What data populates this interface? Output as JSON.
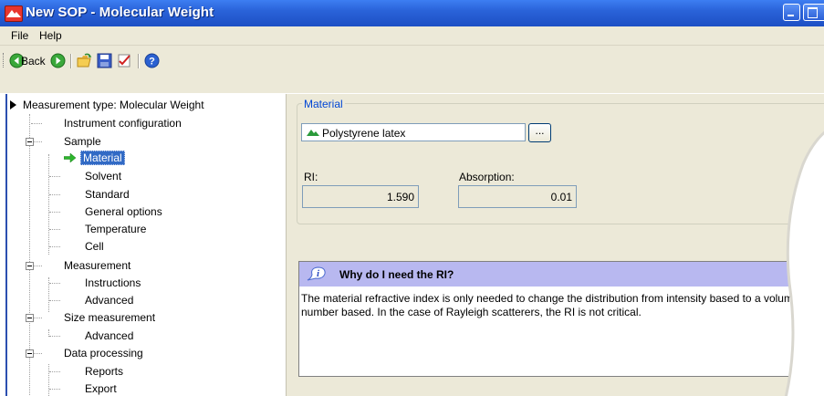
{
  "window": {
    "title": "New SOP - Molecular Weight"
  },
  "menu": {
    "items": [
      "File",
      "Help"
    ]
  },
  "toolbar": {
    "back_label": "Back",
    "icons": [
      "back-icon",
      "forward-icon",
      "open-folder-icon",
      "save-icon",
      "edit-check-icon",
      "help-icon"
    ]
  },
  "tree": {
    "root": "Measurement type: Molecular Weight",
    "items": [
      {
        "label": "Instrument configuration",
        "level": 1,
        "expandable": false
      },
      {
        "label": "Sample",
        "level": 1,
        "expandable": true
      },
      {
        "label": "Material",
        "level": 2,
        "selected": true
      },
      {
        "label": "Solvent",
        "level": 2
      },
      {
        "label": "Standard",
        "level": 2
      },
      {
        "label": "General options",
        "level": 2
      },
      {
        "label": "Temperature",
        "level": 2
      },
      {
        "label": "Cell",
        "level": 2
      },
      {
        "label": "Measurement",
        "level": 1,
        "expandable": true
      },
      {
        "label": "Instructions",
        "level": 2
      },
      {
        "label": "Advanced",
        "level": 2
      },
      {
        "label": "Size measurement",
        "level": 1,
        "expandable": true
      },
      {
        "label": "Advanced",
        "level": 2
      },
      {
        "label": "Data processing",
        "level": 1,
        "expandable": true
      },
      {
        "label": "Reports",
        "level": 2
      },
      {
        "label": "Export",
        "level": 2
      }
    ]
  },
  "material_group": {
    "title": "Material",
    "material_value": "Polystyrene latex",
    "browse_label": "...",
    "ri_label": "RI:",
    "ri_value": "1.590",
    "absorption_label": "Absorption:",
    "absorption_value": "0.01"
  },
  "info": {
    "title": "Why do I need the RI?",
    "body": "The material refractive index is only needed to change the distribution from intensity based to a volume or number based.  In the case of Rayleigh scatterers, the RI is not critical."
  },
  "colors": {
    "titlebar": "#2a63d9",
    "selection": "#316ac5",
    "info_header": "#b8b8f0",
    "group_title": "#0046d5"
  }
}
